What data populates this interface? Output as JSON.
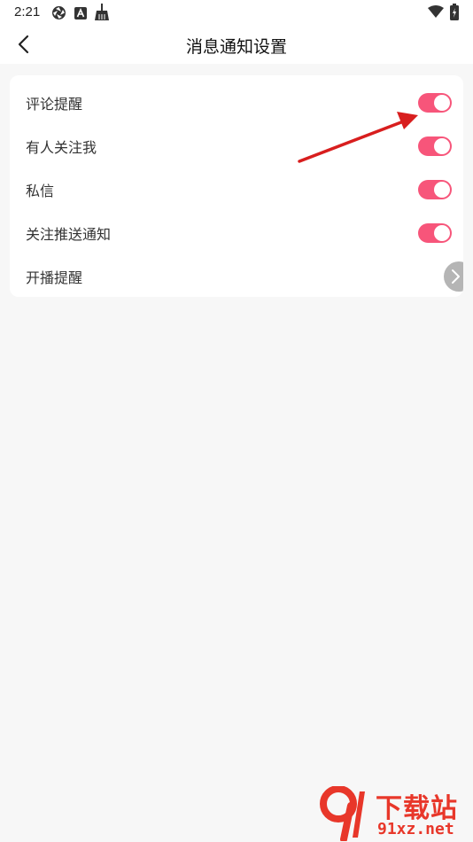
{
  "status_bar": {
    "time": "2:21",
    "left_icons": [
      "aperture-icon",
      "a-badge-icon",
      "broom-icon"
    ],
    "right_icons": [
      "wifi-icon",
      "battery-charging-icon"
    ]
  },
  "header": {
    "back_icon": "chevron-left-icon",
    "title": "消息通知设置"
  },
  "settings": [
    {
      "label": "评论提醒",
      "control": "toggle",
      "on": true
    },
    {
      "label": "有人关注我",
      "control": "toggle",
      "on": true
    },
    {
      "label": "私信",
      "control": "toggle",
      "on": true
    },
    {
      "label": "关注推送通知",
      "control": "toggle",
      "on": true
    },
    {
      "label": "开播提醒",
      "control": "chevron"
    }
  ],
  "colors": {
    "toggle_on": "#f7557a",
    "annotation_arrow": "#d81e1e",
    "watermark": "#e8372a"
  },
  "watermark": {
    "cn": "下载站",
    "en": "91xz.net"
  }
}
